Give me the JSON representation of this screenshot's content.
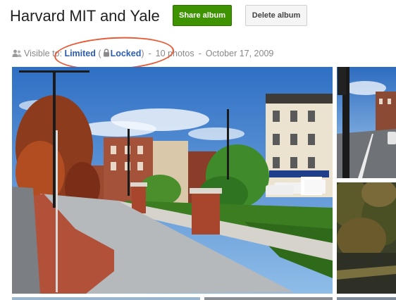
{
  "album": {
    "title": "Harvard MIT and Yale",
    "share_label": "Share album",
    "delete_label": "Delete album"
  },
  "meta": {
    "visible_label": "Visible to:",
    "visibility_value": "Limited",
    "lock_open_paren": "(",
    "lock_label": "Locked",
    "lock_close_paren": ")",
    "separator": "-",
    "photo_count": "10 photos",
    "date": "October 17, 2009"
  },
  "icons": {
    "people": "people-icon",
    "lock": "lock-icon"
  },
  "colors": {
    "share_button": "#3d9400",
    "link": "#2a5db0",
    "highlight_circle": "#e85a35"
  }
}
